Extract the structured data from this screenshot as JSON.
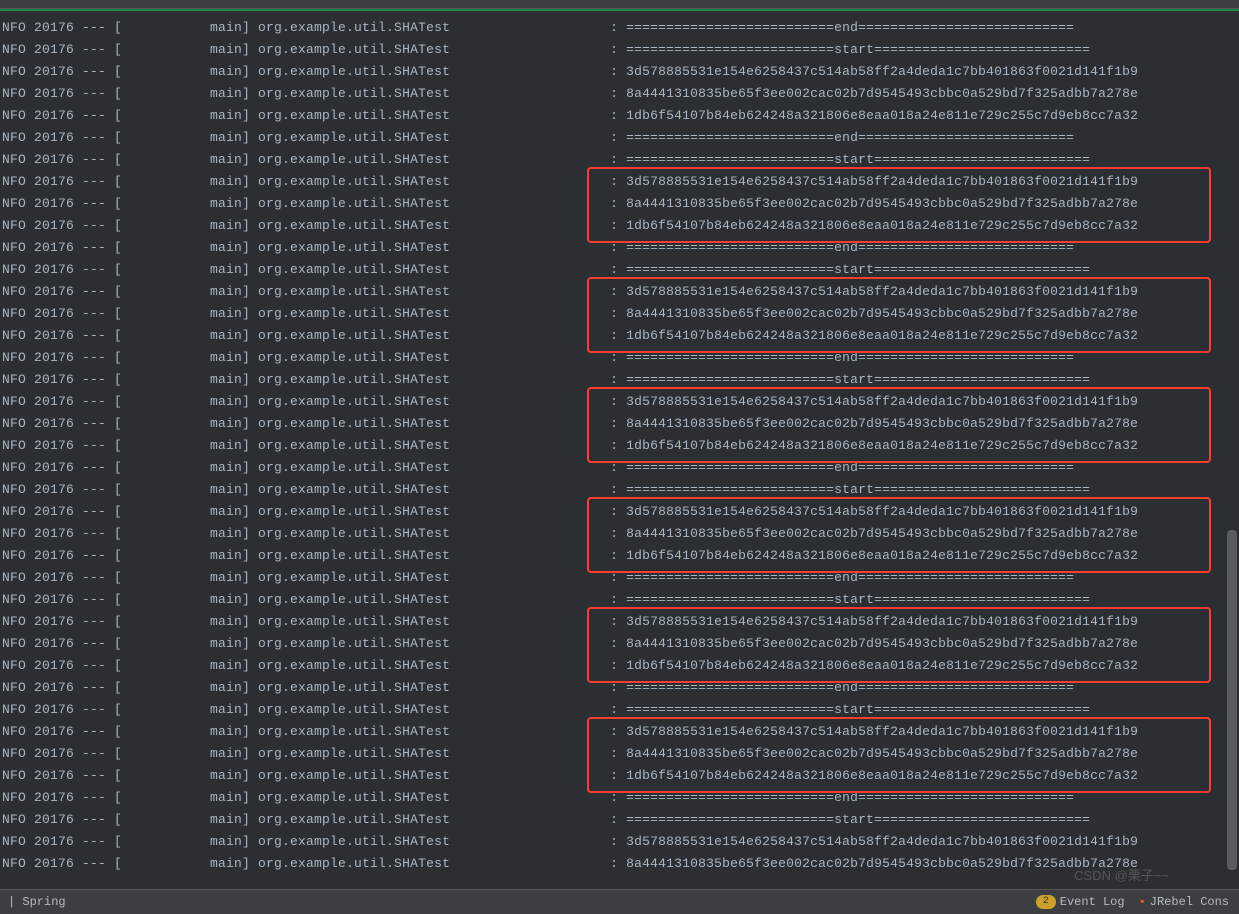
{
  "prefix_left": "NFO 20176 --- [",
  "prefix_mid": "           main] org.example.util.SHATest",
  "prefix_gap": "                    : ",
  "lines_msg": [
    "==========================end===========================",
    "==========================start===========================",
    "3d578885531e154e6258437c514ab58ff2a4deda1c7bb401863f0021d141f1b9",
    "8a4441310835be65f3ee002cac02b7d9545493cbbc0a529bd7f325adbb7a278e",
    "1db6f54107b84eb624248a321806e8eaa018a24e811e729c255c7d9eb8cc7a32",
    "==========================end===========================",
    "==========================start===========================",
    "3d578885531e154e6258437c514ab58ff2a4deda1c7bb401863f0021d141f1b9",
    "8a4441310835be65f3ee002cac02b7d9545493cbbc0a529bd7f325adbb7a278e",
    "1db6f54107b84eb624248a321806e8eaa018a24e811e729c255c7d9eb8cc7a32",
    "==========================end===========================",
    "==========================start===========================",
    "3d578885531e154e6258437c514ab58ff2a4deda1c7bb401863f0021d141f1b9",
    "8a4441310835be65f3ee002cac02b7d9545493cbbc0a529bd7f325adbb7a278e",
    "1db6f54107b84eb624248a321806e8eaa018a24e811e729c255c7d9eb8cc7a32",
    "==========================end===========================",
    "==========================start===========================",
    "3d578885531e154e6258437c514ab58ff2a4deda1c7bb401863f0021d141f1b9",
    "8a4441310835be65f3ee002cac02b7d9545493cbbc0a529bd7f325adbb7a278e",
    "1db6f54107b84eb624248a321806e8eaa018a24e811e729c255c7d9eb8cc7a32",
    "==========================end===========================",
    "==========================start===========================",
    "3d578885531e154e6258437c514ab58ff2a4deda1c7bb401863f0021d141f1b9",
    "8a4441310835be65f3ee002cac02b7d9545493cbbc0a529bd7f325adbb7a278e",
    "1db6f54107b84eb624248a321806e8eaa018a24e811e729c255c7d9eb8cc7a32",
    "==========================end===========================",
    "==========================start===========================",
    "3d578885531e154e6258437c514ab58ff2a4deda1c7bb401863f0021d141f1b9",
    "8a4441310835be65f3ee002cac02b7d9545493cbbc0a529bd7f325adbb7a278e",
    "1db6f54107b84eb624248a321806e8eaa018a24e811e729c255c7d9eb8cc7a32",
    "==========================end===========================",
    "==========================start===========================",
    "3d578885531e154e6258437c514ab58ff2a4deda1c7bb401863f0021d141f1b9",
    "8a4441310835be65f3ee002cac02b7d9545493cbbc0a529bd7f325adbb7a278e",
    "1db6f54107b84eb624248a321806e8eaa018a24e811e729c255c7d9eb8cc7a32",
    "==========================end===========================",
    "==========================start===========================",
    "3d578885531e154e6258437c514ab58ff2a4deda1c7bb401863f0021d141f1b9",
    "8a4441310835be65f3ee002cac02b7d9545493cbbc0a529bd7f325adbb7a278e"
  ],
  "highlight_groups": [
    [
      7,
      8,
      9
    ],
    [
      12,
      13,
      14
    ],
    [
      17,
      18,
      19
    ],
    [
      22,
      23,
      24
    ],
    [
      27,
      28,
      29
    ],
    [
      32,
      33,
      34
    ]
  ],
  "statusbar": {
    "left": "| Spring",
    "badge_count": "2",
    "event_log": "Event Log",
    "jrebel": "JRebel Cons"
  },
  "watermark": "CSDN @栗子~~"
}
